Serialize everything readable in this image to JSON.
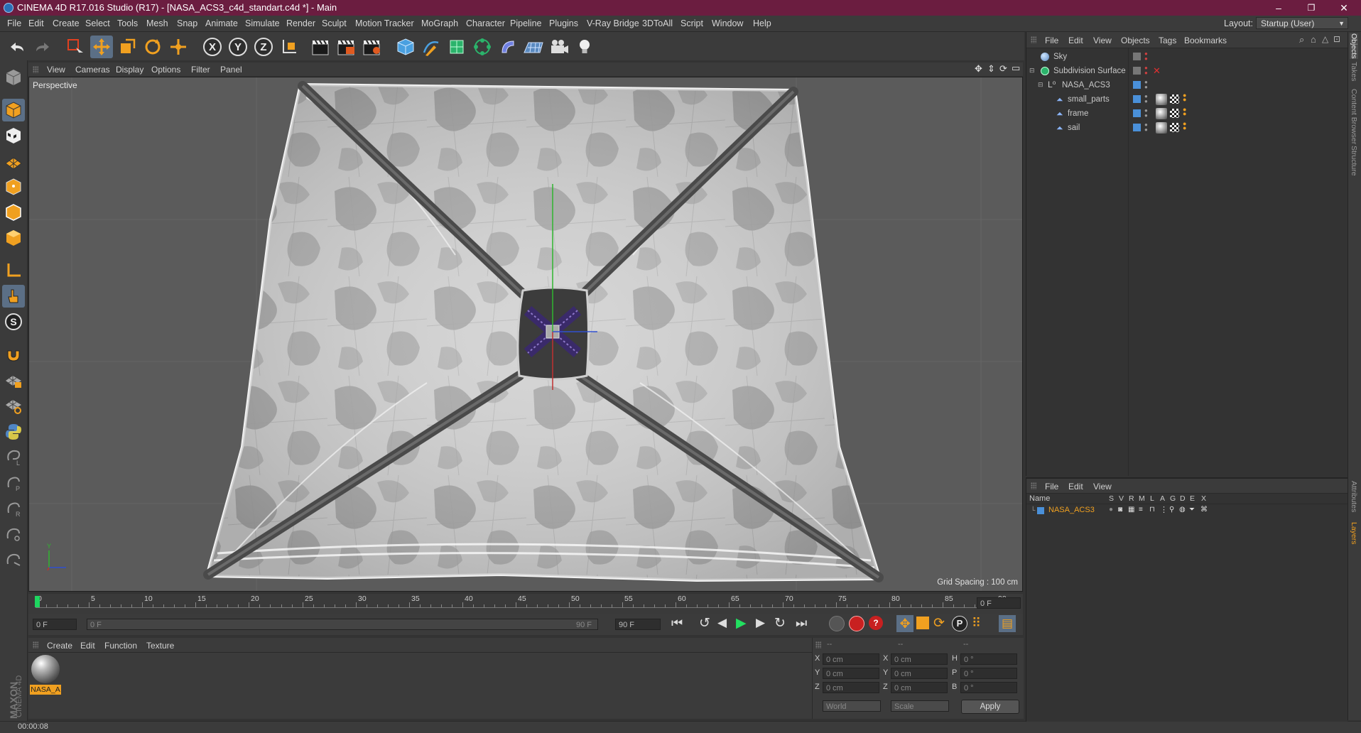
{
  "window": {
    "title": "CINEMA 4D R17.016 Studio (R17) - [NASA_ACS3_c4d_standart.c4d *] - Main",
    "minimize": "–",
    "restore": "❐",
    "close": "✕"
  },
  "menubar": {
    "items": [
      "File",
      "Edit",
      "Create",
      "Select",
      "Tools",
      "Mesh",
      "Snap",
      "Animate",
      "Simulate",
      "Render",
      "Sculpt",
      "Motion Tracker",
      "MoGraph",
      "Character",
      "Pipeline",
      "Plugins",
      "V-Ray Bridge",
      "3DToAll",
      "Script",
      "Window",
      "Help"
    ],
    "layout_label": "Layout:",
    "layout_value": "Startup (User)"
  },
  "viewport": {
    "menu": [
      "View",
      "Cameras",
      "Display",
      "Options",
      "Filter",
      "Panel"
    ],
    "camera_label": "Perspective",
    "grid_spacing": "Grid Spacing : 100 cm"
  },
  "timeline": {
    "ticks": [
      "0",
      "5",
      "10",
      "15",
      "20",
      "25",
      "30",
      "35",
      "40",
      "45",
      "50",
      "55",
      "60",
      "65",
      "70",
      "75",
      "80",
      "85",
      "90"
    ],
    "current_frame": "0 F",
    "start_field": "0 F",
    "range_start": "0 F",
    "range_end": "90 F",
    "end_field": "90 F"
  },
  "material_manager": {
    "menu": [
      "Create",
      "Edit",
      "Function",
      "Texture"
    ],
    "materials": [
      {
        "name": "NASA_A"
      }
    ]
  },
  "coordinates": {
    "header1": "--",
    "header2": "--",
    "header3": "--",
    "rows": [
      {
        "axis": "X",
        "pos": "0 cm",
        "size_axis": "X",
        "size": "0 cm",
        "rot_axis": "H",
        "rot": "0 °"
      },
      {
        "axis": "Y",
        "pos": "0 cm",
        "size_axis": "Y",
        "size": "0 cm",
        "rot_axis": "P",
        "rot": "0 °"
      },
      {
        "axis": "Z",
        "pos": "0 cm",
        "size_axis": "Z",
        "size": "0 cm",
        "rot_axis": "B",
        "rot": "0 °"
      }
    ],
    "mode_world": "World",
    "mode_scale": "Scale",
    "apply": "Apply"
  },
  "object_manager": {
    "menu": [
      "File",
      "Edit",
      "View",
      "Objects",
      "Tags",
      "Bookmarks"
    ],
    "objects": [
      {
        "name": "Sky"
      },
      {
        "name": "Subdivision Surface"
      },
      {
        "name": "NASA_ACS3"
      },
      {
        "name": "small_parts"
      },
      {
        "name": "frame"
      },
      {
        "name": "sail"
      }
    ]
  },
  "layer_manager": {
    "menu": [
      "File",
      "Edit",
      "View"
    ],
    "columns": [
      "Name",
      "S",
      "V",
      "R",
      "M",
      "L",
      "A",
      "G",
      "D",
      "E",
      "X"
    ],
    "layers": [
      {
        "name": "NASA_ACS3",
        "color": "#4a90d9"
      }
    ]
  },
  "right_tabs": [
    "Objects",
    "Takes",
    "Content Browser",
    "Structure",
    "Attributes",
    "Layers"
  ],
  "brand": {
    "maxon": "MAXON",
    "product": "CINEMA 4D"
  },
  "status": {
    "time": "00:00:08"
  },
  "colors": {
    "titlebar": "#6b1d40",
    "accent_orange": "#f0a020",
    "active_tool": "#5b6f86"
  }
}
